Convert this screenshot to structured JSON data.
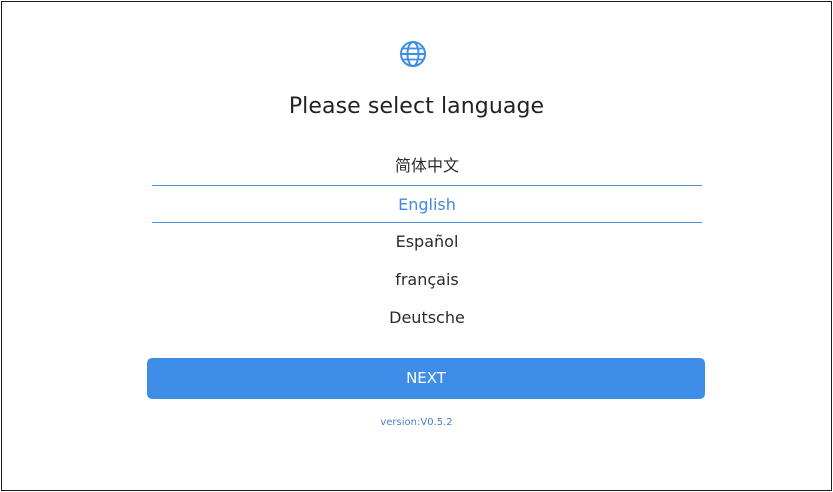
{
  "title": "Please select language",
  "icons": {
    "globe": "globe-icon"
  },
  "languages": [
    {
      "label": "简体中文",
      "selected": false
    },
    {
      "label": "English",
      "selected": true
    },
    {
      "label": "Español",
      "selected": false
    },
    {
      "label": "français",
      "selected": false
    },
    {
      "label": "Deutsche",
      "selected": false
    }
  ],
  "next_label": "NEXT",
  "version": "version:V0.5.2",
  "colors": {
    "accent": "#3e8ee8",
    "selected_text": "#3f8ae4",
    "selected_border": "#4a90e2",
    "version_text": "#4a7fc0"
  }
}
